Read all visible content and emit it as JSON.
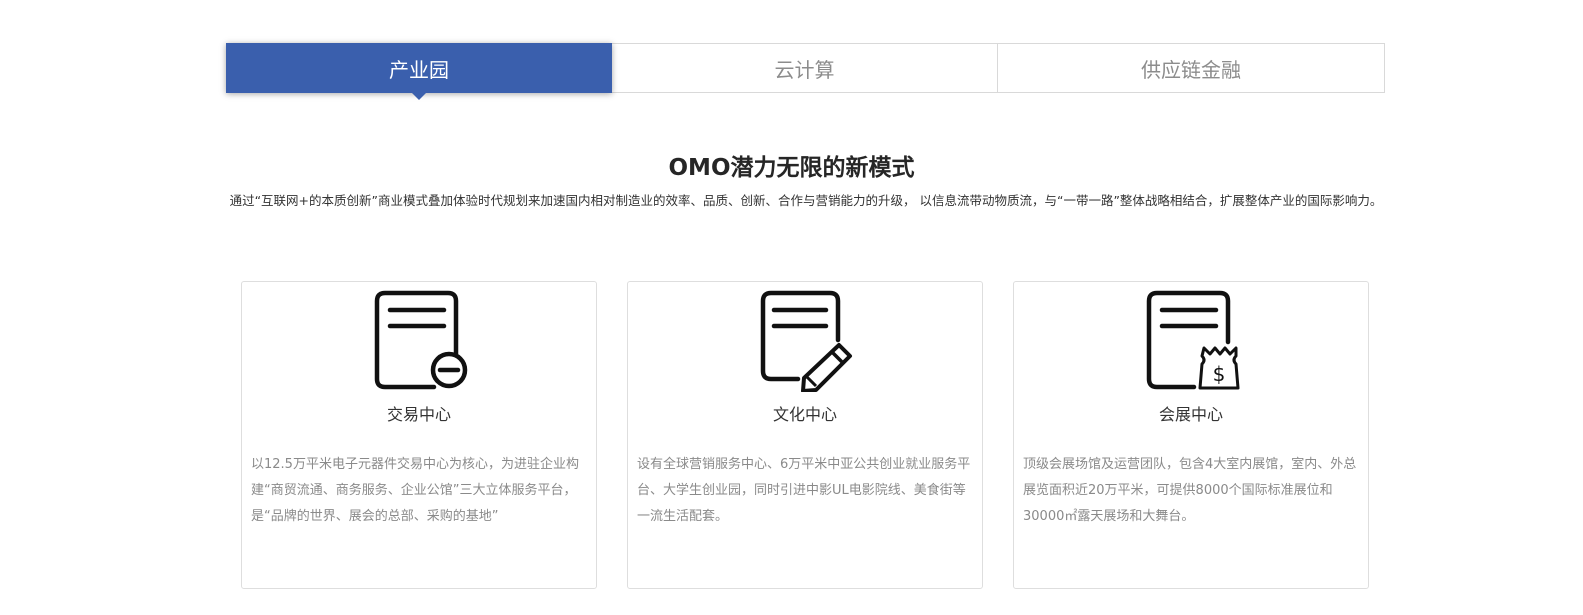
{
  "tabs": [
    {
      "label": "产业园",
      "active": true
    },
    {
      "label": "云计算",
      "active": false
    },
    {
      "label": "供应链金融",
      "active": false
    }
  ],
  "section": {
    "title": "OMO潜力无限的新模式",
    "intro": "通过“互联网+的本质创新”商业模式叠加体验时代规划来加速国内相对制造业的效率、品质、创新、合作与营销能力的升级， 以信息流带动物质流，与“一带一路”整体战略相结合，扩展整体产业的国际影响力。"
  },
  "cards": [
    {
      "icon": "document-minus-icon",
      "title": "交易中心",
      "desc": "以12.5万平米电子元器件交易中心为核心，为进驻企业构建“商贸流通、商务服务、企业公馆”三大立体服务平台，是“品牌的世界、展会的总部、采购的基地”"
    },
    {
      "icon": "document-pencil-icon",
      "title": "文化中心",
      "desc": "设有全球营销服务中心、6万平米中亚公共创业就业服务平台、大学生创业园，同时引进中影UL电影院线、美食街等一流生活配套。"
    },
    {
      "icon": "document-money-bag-icon",
      "title": "会展中心",
      "desc": "顶级会展场馆及运营团队，包含4大室内展馆，室内、外总展览面积近20万平米，可提供8000个国际标准展位和30000㎡露天展场和大舞台。"
    }
  ],
  "colors": {
    "accent": "#3a5fad",
    "card_border": "#dedede",
    "muted_text": "#8a8a8a"
  }
}
